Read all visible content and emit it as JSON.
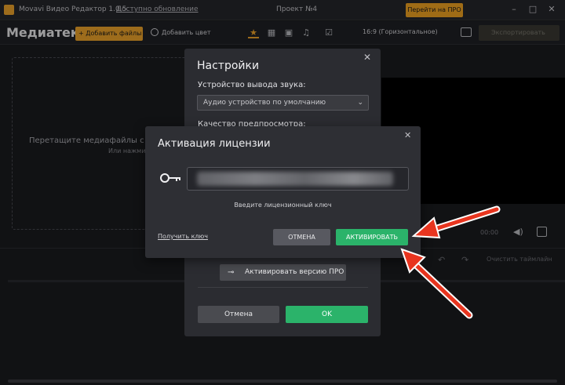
{
  "titlebar": {
    "app_title": "Movavi Видео Редактор 1.0.5",
    "update_link": "Доступно обновление",
    "project_name": "Проект №4",
    "pro_button": "Перейти на ПРО",
    "minimize": "–",
    "maximize": "□",
    "close": "✕"
  },
  "toolbar": {
    "media_title": "Медиатека",
    "add_files": "+ Добавить файлы",
    "add_color": "Добавить цвет",
    "aspect_ratio": "16:9 (Горизонтальное)",
    "export": "Экспортировать"
  },
  "media": {
    "drop_text": "Перетащите медиафайлы с",
    "drop_sub": "Или нажми"
  },
  "player": {
    "time": "00:00"
  },
  "timeline": {
    "clear": "Очистить таймлайн"
  },
  "settings": {
    "title": "Настройки",
    "audio_label": "Устройство вывода звука:",
    "audio_value": "Аудио устройство по умолчанию",
    "preview_quality": "Качество предпросмотра:",
    "activate_pro": "Активировать версию ПРО",
    "cancel": "Отмена",
    "ok": "OK"
  },
  "license": {
    "title": "Активация лицензии",
    "key_hint": "Введите лицензионный ключ",
    "get_key": "Получить ключ",
    "cancel": "ОТМЕНА",
    "activate": "АКТИВИРОВАТЬ"
  },
  "colors": {
    "accent": "#f2a72b",
    "green": "#2bb36a",
    "arrow": "#e8351f"
  },
  "icons": {
    "star": "star-icon",
    "film": "film-icon",
    "image": "image-icon",
    "music": "music-icon",
    "check": "checkbox-icon",
    "key": "key-icon"
  }
}
